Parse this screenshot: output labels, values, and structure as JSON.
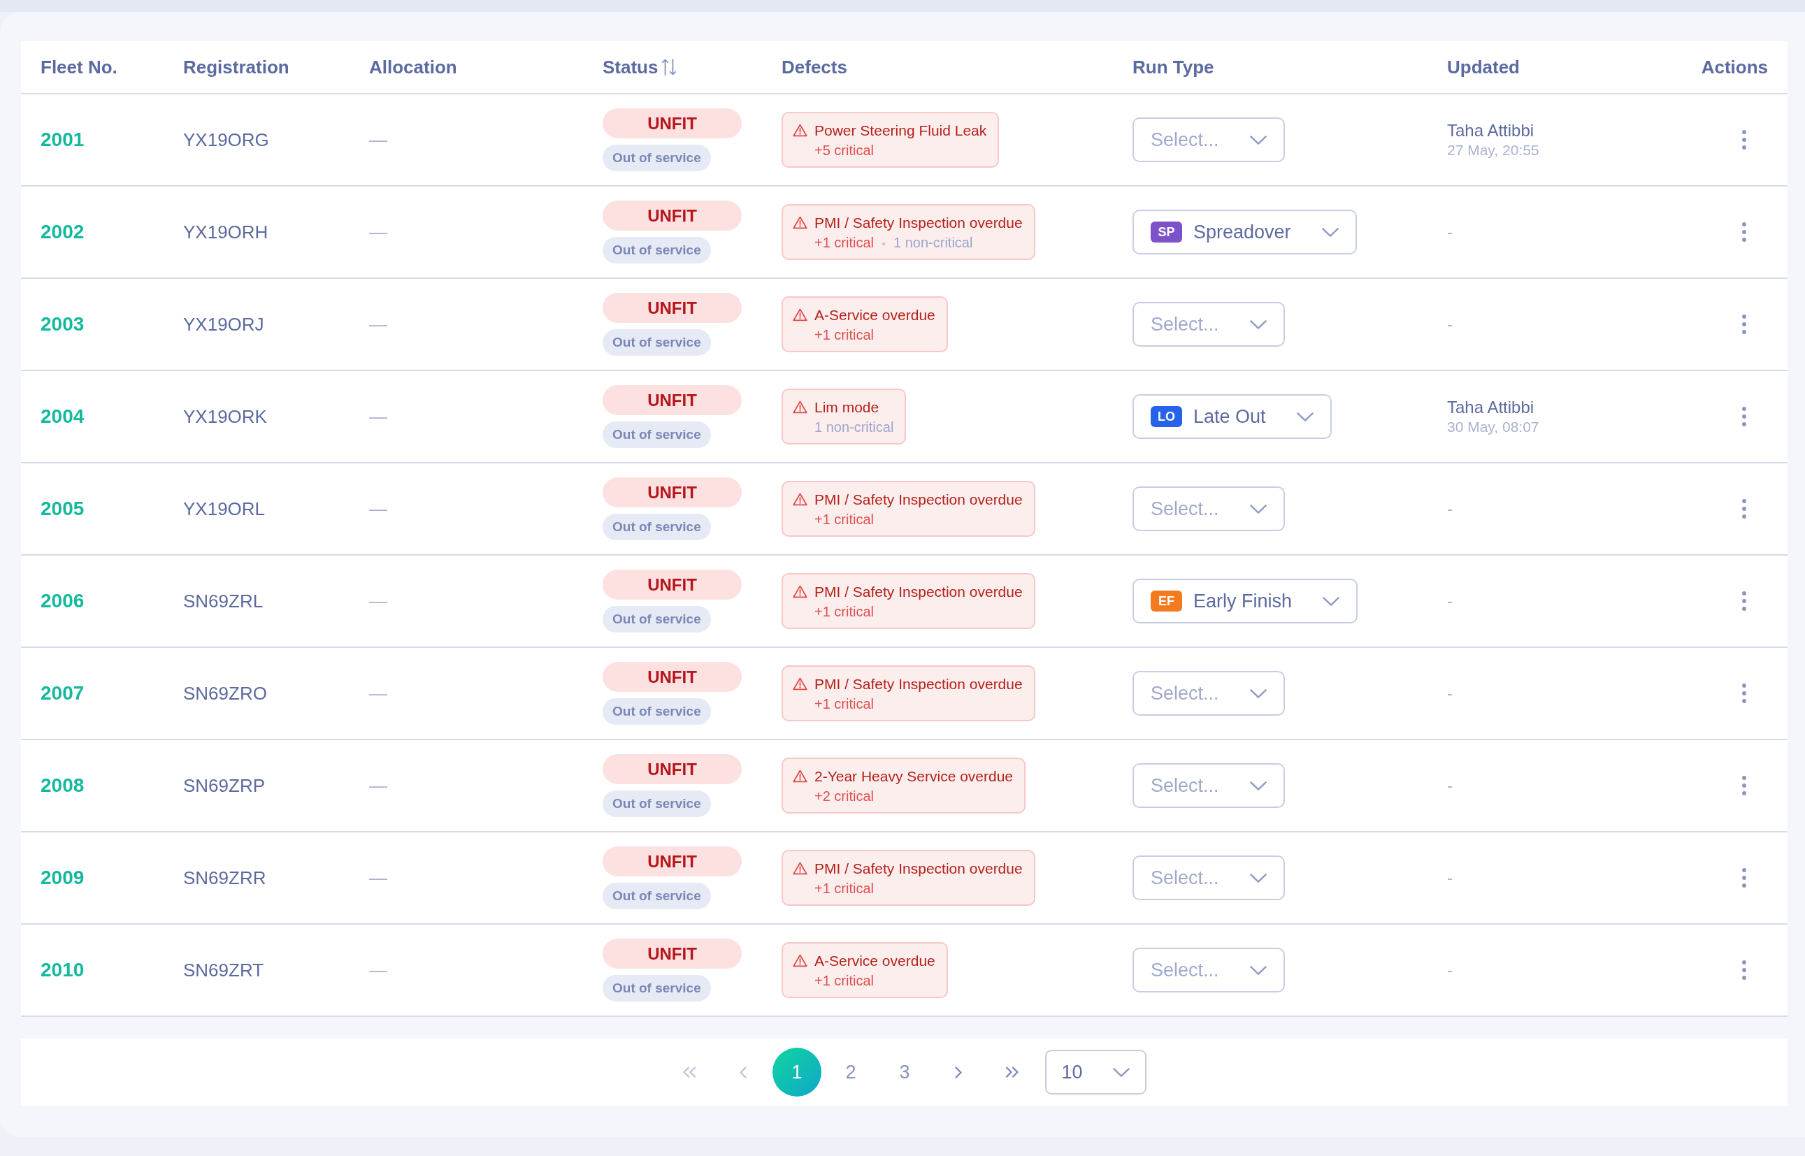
{
  "table": {
    "columns": [
      {
        "label": "Fleet No.",
        "sortable": false
      },
      {
        "label": "Registration",
        "sortable": false
      },
      {
        "label": "Allocation",
        "sortable": false
      },
      {
        "label": "Status",
        "sortable": true
      },
      {
        "label": "Defects",
        "sortable": false
      },
      {
        "label": "Run Type",
        "sortable": false
      },
      {
        "label": "Updated",
        "sortable": false
      },
      {
        "label": "Actions",
        "sortable": false
      }
    ],
    "rows": [
      {
        "fleet_no": "2001",
        "registration": "YX19ORG",
        "allocation": "—",
        "status": "UNFIT",
        "status_detail": "Out of service",
        "defect": {
          "title": "Power Steering Fluid Leak",
          "critical": "+5 critical"
        },
        "run_type": {
          "placeholder": "Select..."
        },
        "updated": {
          "user": "Taha Attibbi",
          "time": "27 May, 20:55"
        }
      },
      {
        "fleet_no": "2002",
        "registration": "YX19ORH",
        "allocation": "—",
        "status": "UNFIT",
        "status_detail": "Out of service",
        "defect": {
          "title": "PMI / Safety Inspection overdue",
          "critical": "+1 critical",
          "non_critical": "1 non-critical"
        },
        "run_type": {
          "code": "SP",
          "value": "Spreadover",
          "color": "#7b52c7"
        },
        "updated": {
          "text": "-"
        }
      },
      {
        "fleet_no": "2003",
        "registration": "YX19ORJ",
        "allocation": "—",
        "status": "UNFIT",
        "status_detail": "Out of service",
        "defect": {
          "title": "A-Service overdue",
          "critical": "+1 critical"
        },
        "run_type": {
          "placeholder": "Select..."
        },
        "updated": {
          "text": "-"
        }
      },
      {
        "fleet_no": "2004",
        "registration": "YX19ORK",
        "allocation": "—",
        "status": "UNFIT",
        "status_detail": "Out of service",
        "defect": {
          "title": "Lim mode",
          "non_critical": "1 non-critical"
        },
        "run_type": {
          "code": "LO",
          "value": "Late Out",
          "color": "#2563eb"
        },
        "updated": {
          "user": "Taha Attibbi",
          "time": "30 May, 08:07"
        }
      },
      {
        "fleet_no": "2005",
        "registration": "YX19ORL",
        "allocation": "—",
        "status": "UNFIT",
        "status_detail": "Out of service",
        "defect": {
          "title": "PMI / Safety Inspection overdue",
          "critical": "+1 critical"
        },
        "run_type": {
          "placeholder": "Select..."
        },
        "updated": {
          "text": "-"
        }
      },
      {
        "fleet_no": "2006",
        "registration": "SN69ZRL",
        "allocation": "—",
        "status": "UNFIT",
        "status_detail": "Out of service",
        "defect": {
          "title": "PMI / Safety Inspection overdue",
          "critical": "+1 critical"
        },
        "run_type": {
          "code": "EF",
          "value": "Early Finish",
          "color": "#f47a1f"
        },
        "updated": {
          "text": "-"
        }
      },
      {
        "fleet_no": "2007",
        "registration": "SN69ZRO",
        "allocation": "—",
        "status": "UNFIT",
        "status_detail": "Out of service",
        "defect": {
          "title": "PMI / Safety Inspection overdue",
          "critical": "+1 critical"
        },
        "run_type": {
          "placeholder": "Select..."
        },
        "updated": {
          "text": "-"
        }
      },
      {
        "fleet_no": "2008",
        "registration": "SN69ZRP",
        "allocation": "—",
        "status": "UNFIT",
        "status_detail": "Out of service",
        "defect": {
          "title": "2-Year Heavy Service overdue",
          "critical": "+2 critical"
        },
        "run_type": {
          "placeholder": "Select..."
        },
        "updated": {
          "text": "-"
        }
      },
      {
        "fleet_no": "2009",
        "registration": "SN69ZRR",
        "allocation": "—",
        "status": "UNFIT",
        "status_detail": "Out of service",
        "defect": {
          "title": "PMI / Safety Inspection overdue",
          "critical": "+1 critical"
        },
        "run_type": {
          "placeholder": "Select..."
        },
        "updated": {
          "text": "-"
        }
      },
      {
        "fleet_no": "2010",
        "registration": "SN69ZRT",
        "allocation": "—",
        "status": "UNFIT",
        "status_detail": "Out of service",
        "defect": {
          "title": "A-Service overdue",
          "critical": "+1 critical"
        },
        "run_type": {
          "placeholder": "Select..."
        },
        "updated": {
          "text": "-"
        }
      }
    ]
  },
  "pagination": {
    "first": {
      "disabled": true
    },
    "previous": {
      "disabled": true
    },
    "pages": [
      {
        "label": "1",
        "selected": true
      },
      {
        "label": "2",
        "selected": false
      },
      {
        "label": "3",
        "selected": false
      }
    ],
    "next": {
      "disabled": false
    },
    "last": {
      "disabled": false
    },
    "page_size": "10"
  }
}
